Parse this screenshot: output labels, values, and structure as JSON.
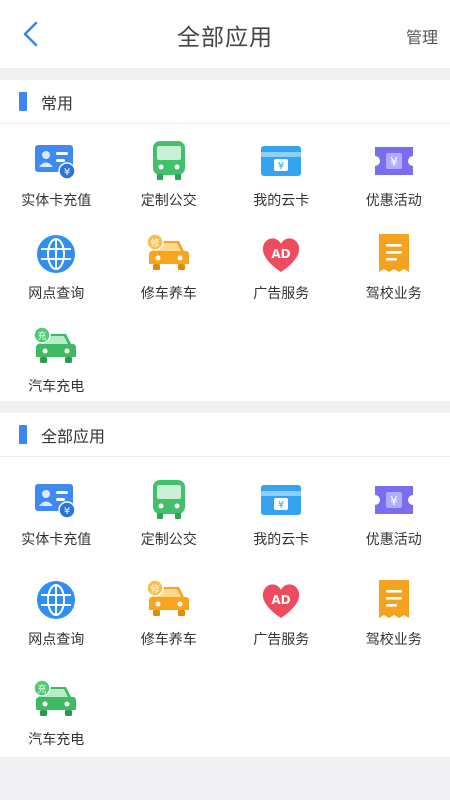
{
  "header": {
    "title": "全部应用",
    "manage_label": "管理",
    "back_icon": "chevron-left-icon"
  },
  "colors": {
    "accent": "#3b86f0",
    "background": "#f1f1f3"
  },
  "sections": [
    {
      "title": "常用",
      "items": [
        {
          "label": "实体卡充值",
          "icon": "id-card-icon"
        },
        {
          "label": "定制公交",
          "icon": "bus-icon"
        },
        {
          "label": "我的云卡",
          "icon": "cloud-card-icon"
        },
        {
          "label": "优惠活动",
          "icon": "coupon-icon"
        },
        {
          "label": "网点查询",
          "icon": "globe-icon"
        },
        {
          "label": "修车养车",
          "icon": "car-repair-icon"
        },
        {
          "label": "广告服务",
          "icon": "ad-heart-icon"
        },
        {
          "label": "驾校业务",
          "icon": "receipt-icon"
        },
        {
          "label": "汽车充电",
          "icon": "car-charge-icon"
        }
      ]
    },
    {
      "title": "全部应用",
      "items": [
        {
          "label": "实体卡充值",
          "icon": "id-card-icon"
        },
        {
          "label": "定制公交",
          "icon": "bus-icon"
        },
        {
          "label": "我的云卡",
          "icon": "cloud-card-icon"
        },
        {
          "label": "优惠活动",
          "icon": "coupon-icon"
        },
        {
          "label": "网点查询",
          "icon": "globe-icon"
        },
        {
          "label": "修车养车",
          "icon": "car-repair-icon"
        },
        {
          "label": "广告服务",
          "icon": "ad-heart-icon"
        },
        {
          "label": "驾校业务",
          "icon": "receipt-icon"
        },
        {
          "label": "汽车充电",
          "icon": "car-charge-icon"
        }
      ]
    }
  ]
}
